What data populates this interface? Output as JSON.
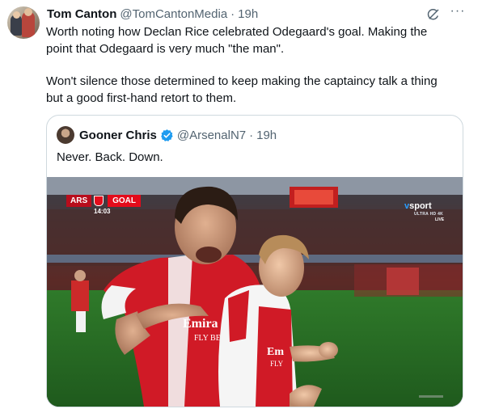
{
  "tweet": {
    "author_name": "Tom Canton",
    "author_handle": "@TomCantonMedia",
    "separator": "·",
    "time": "19h",
    "text_line1": "Worth noting how Declan Rice celebrated Odegaard's goal. Making the",
    "text_line2": "point that Odegaard is very much \"the man\".",
    "text_line3": "Won't silence those determined to keep making the captaincy talk a thing",
    "text_line4": "but a good first-hand retort to them.",
    "icons": [
      "grok-icon",
      "more-icon"
    ],
    "more_label": "···"
  },
  "quoted_tweet": {
    "author_name": "Gooner Chris",
    "verified": true,
    "author_handle": "@ArsenalN7",
    "separator": "·",
    "time": "19h",
    "text": "Never. Back. Down.",
    "media": {
      "scorebug_team": "ARS",
      "scorebug_event": "GOAL",
      "scorebug_clock": "14:03",
      "broadcaster": "sport",
      "broadcaster_sub": "ULTRA HD 4K",
      "broadcaster_live": "LIVE",
      "shirt_sponsor": "Emirates FLY BETTER"
    }
  },
  "colors": {
    "text_primary": "#0f1419",
    "text_secondary": "#536471",
    "border": "#cfd9de",
    "verified_blue": "#1d9bf0",
    "arsenal_red": "#e30b1b"
  }
}
